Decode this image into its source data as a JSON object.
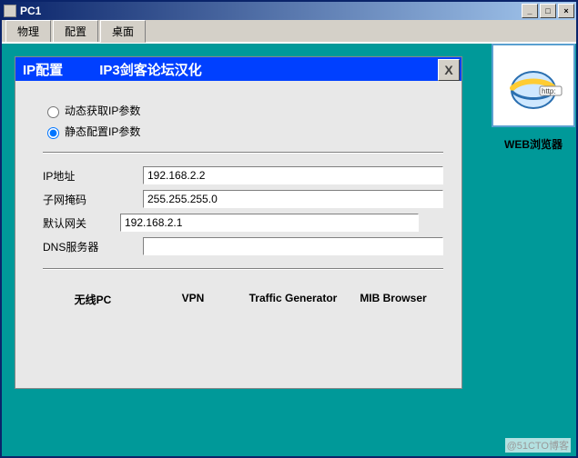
{
  "window": {
    "title": "PC1",
    "minimize": "_",
    "maximize": "□",
    "close": "×"
  },
  "tabs": {
    "a": "物理",
    "b": "配置",
    "c": "桌面",
    "active": "c"
  },
  "panel": {
    "title1": "IP配置",
    "title2": "IP3剑客论坛汉化",
    "close": "X",
    "radio_dhcp": "动态获取IP参数",
    "radio_static": "静态配置IP参数",
    "labels": {
      "ip": "IP地址",
      "mask": "子网掩码",
      "gateway": "默认网关",
      "dns": "DNS服务器"
    },
    "values": {
      "ip": "192.168.2.2",
      "mask": "255.255.255.0",
      "gateway": "192.168.2.1",
      "dns": ""
    }
  },
  "bottom": {
    "a": "无线PC",
    "b": "VPN",
    "c": "Traffic Generator",
    "d": "MIB Browser"
  },
  "browser": {
    "label": "WEB浏览器",
    "badge": "http:"
  },
  "watermark": "@51CTO博客"
}
